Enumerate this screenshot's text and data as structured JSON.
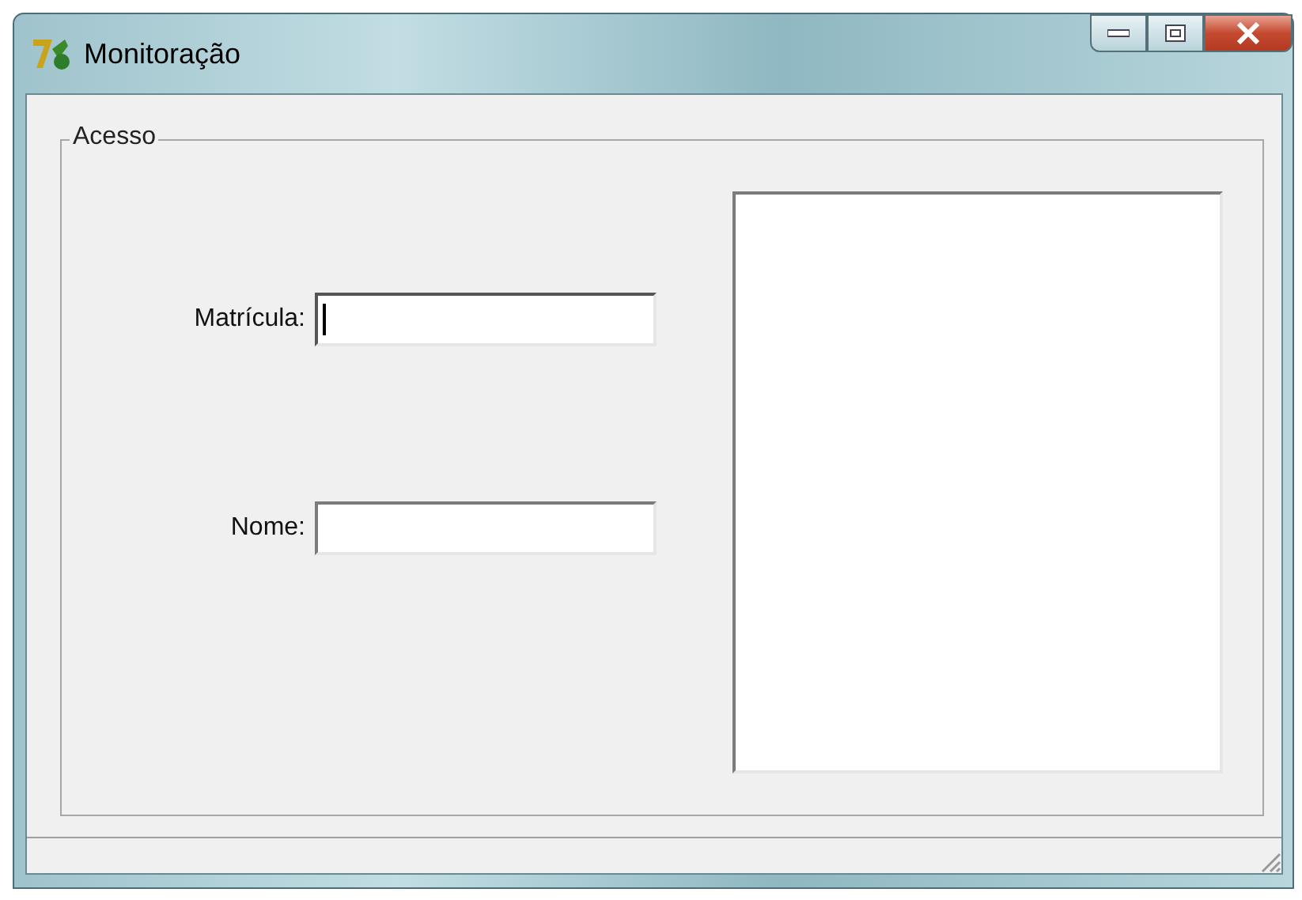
{
  "window": {
    "title": "Monitoração"
  },
  "group": {
    "title": "Acesso"
  },
  "fields": [
    {
      "label": "Matrícula:",
      "focused": true
    },
    {
      "label": "Nome:",
      "focused": false
    }
  ]
}
